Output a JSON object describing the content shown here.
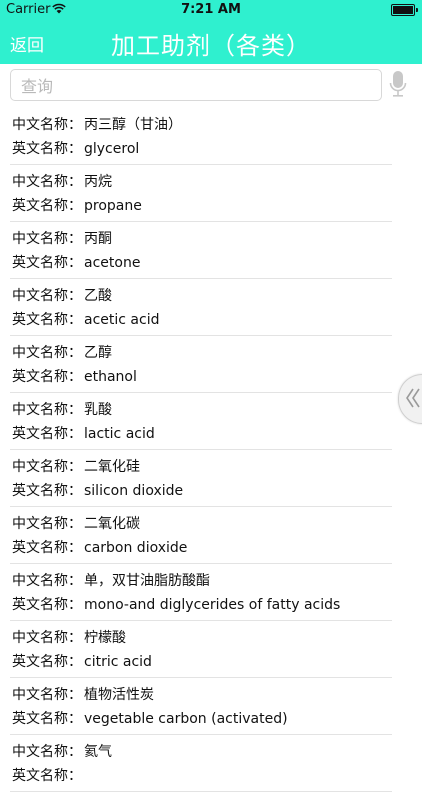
{
  "status": {
    "carrier": "Carrier",
    "time": "7:21 AM"
  },
  "nav": {
    "back": "返回",
    "title": "加工助剂（各类）"
  },
  "search": {
    "placeholder": "查询"
  },
  "labels": {
    "cn": "中文名称：",
    "en": "英文名称："
  },
  "items": [
    {
      "cn": "丙三醇（甘油）",
      "en": "glycerol"
    },
    {
      "cn": "丙烷",
      "en": "propane"
    },
    {
      "cn": "丙酮",
      "en": "acetone"
    },
    {
      "cn": "乙酸",
      "en": "acetic acid"
    },
    {
      "cn": "乙醇",
      "en": "ethanol"
    },
    {
      "cn": "乳酸",
      "en": "lactic acid"
    },
    {
      "cn": "二氧化硅",
      "en": "silicon dioxide"
    },
    {
      "cn": "二氧化碳",
      "en": "carbon dioxide"
    },
    {
      "cn": "单，双甘油脂肪酸酯",
      "en": "mono-and diglycerides of fatty acids"
    },
    {
      "cn": "柠檬酸",
      "en": "citric acid"
    },
    {
      "cn": "植物活性炭",
      "en": "vegetable carbon (activated)"
    },
    {
      "cn": "氦气",
      "en": ""
    }
  ],
  "icons": {
    "wifi": "wifi-icon",
    "battery": "battery-icon",
    "mic": "microphone-icon",
    "handle": "double-chevron-left-icon"
  },
  "colors": {
    "accent": "#2ff0cf"
  }
}
